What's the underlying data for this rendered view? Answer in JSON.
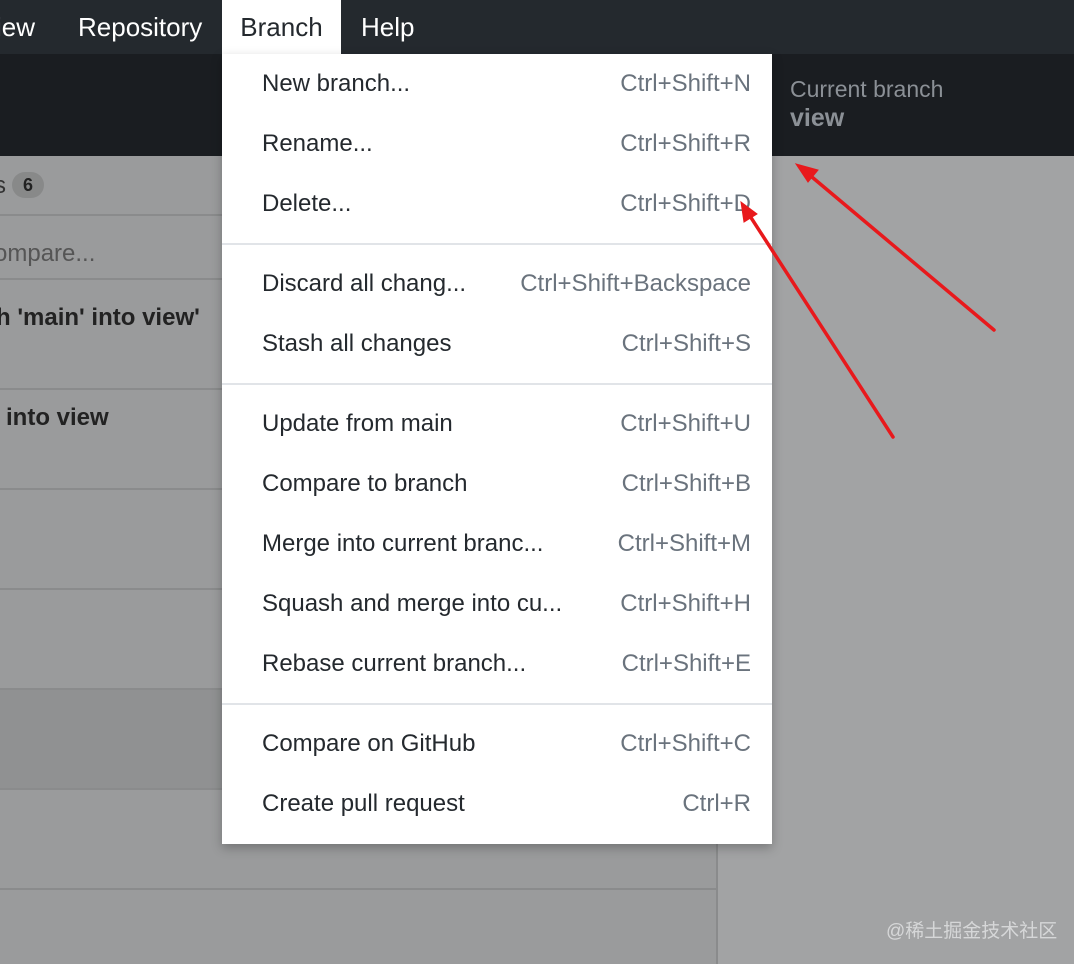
{
  "menubar": {
    "items": [
      {
        "label": "iew"
      },
      {
        "label": "Repository"
      },
      {
        "label": "Branch"
      },
      {
        "label": "Help"
      }
    ],
    "active": "Branch"
  },
  "toolbar": {
    "current_branch_label": "Current branch",
    "current_branch_name": "view"
  },
  "sidebar": {
    "tab_label": "s",
    "badge_count": "6",
    "compare_text": "ompare...",
    "commits": [
      {
        "title": "h 'main' into view'"
      },
      {
        "title": "into view"
      }
    ]
  },
  "branch_menu": {
    "groups": [
      [
        {
          "label": "New branch...",
          "accelerator": "Ctrl+Shift+N"
        },
        {
          "label": "Rename...",
          "accelerator": "Ctrl+Shift+R"
        },
        {
          "label": "Delete...",
          "accelerator": "Ctrl+Shift+D"
        }
      ],
      [
        {
          "label": "Discard all chang...",
          "accelerator": "Ctrl+Shift+Backspace"
        },
        {
          "label": "Stash all changes",
          "accelerator": "Ctrl+Shift+S"
        }
      ],
      [
        {
          "label": "Update from main",
          "accelerator": "Ctrl+Shift+U"
        },
        {
          "label": "Compare to branch",
          "accelerator": "Ctrl+Shift+B"
        },
        {
          "label": "Merge into current branc...",
          "accelerator": "Ctrl+Shift+M"
        },
        {
          "label": "Squash and merge into cu...",
          "accelerator": "Ctrl+Shift+H"
        },
        {
          "label": "Rebase current branch...",
          "accelerator": "Ctrl+Shift+E"
        }
      ],
      [
        {
          "label": "Compare on GitHub",
          "accelerator": "Ctrl+Shift+C"
        },
        {
          "label": "Create pull request",
          "accelerator": "Ctrl+R"
        }
      ]
    ]
  },
  "watermark": "@稀土掘金技术社区",
  "colors": {
    "titlebar": "#24292e",
    "toolbar_dimmed": "#1a1d21",
    "menu_bg": "#ffffff",
    "menu_text": "#24292e",
    "accelerator_text": "#6a737d",
    "overlay_gray": "#a2a3a4",
    "arrow": "#e8191c"
  }
}
